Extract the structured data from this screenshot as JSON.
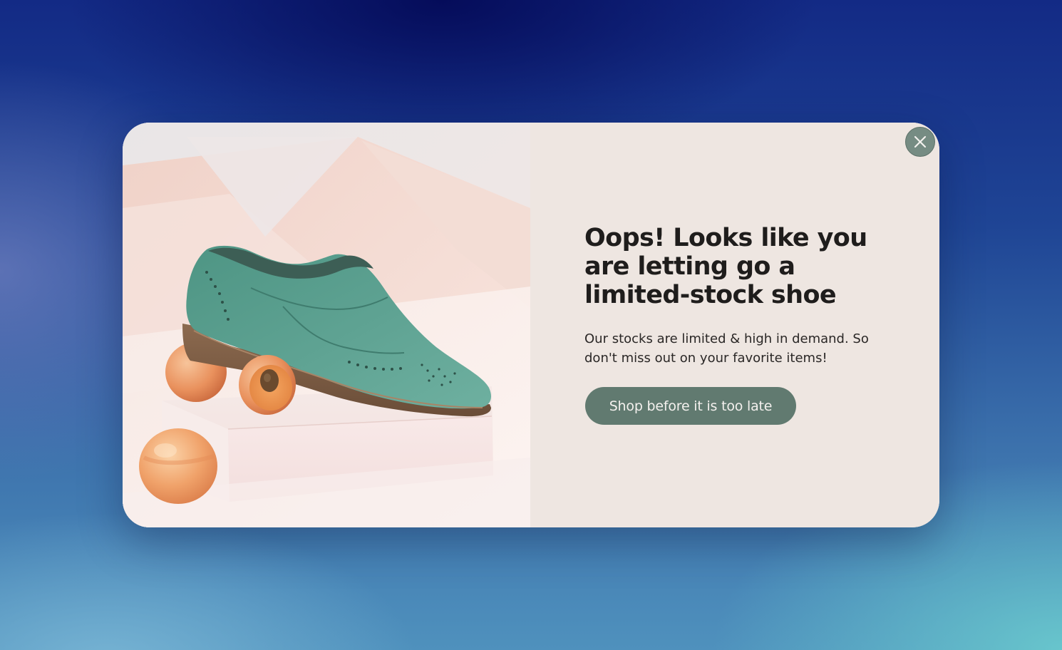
{
  "popup": {
    "headline": "Oops! Looks like you are letting go a limited-stock shoe",
    "subtext": "Our stocks are limited & high in demand. So don't miss out on your favorite items!",
    "cta_label": "Shop before it is too late",
    "close_icon": "close-icon",
    "image_subject": "green suede brogue shoe on pink box with apricots"
  },
  "colors": {
    "cta_background": "#617a70",
    "close_background": "#768c83",
    "panel_background": "#eee6e1",
    "headline_text": "#1f1d1c"
  }
}
